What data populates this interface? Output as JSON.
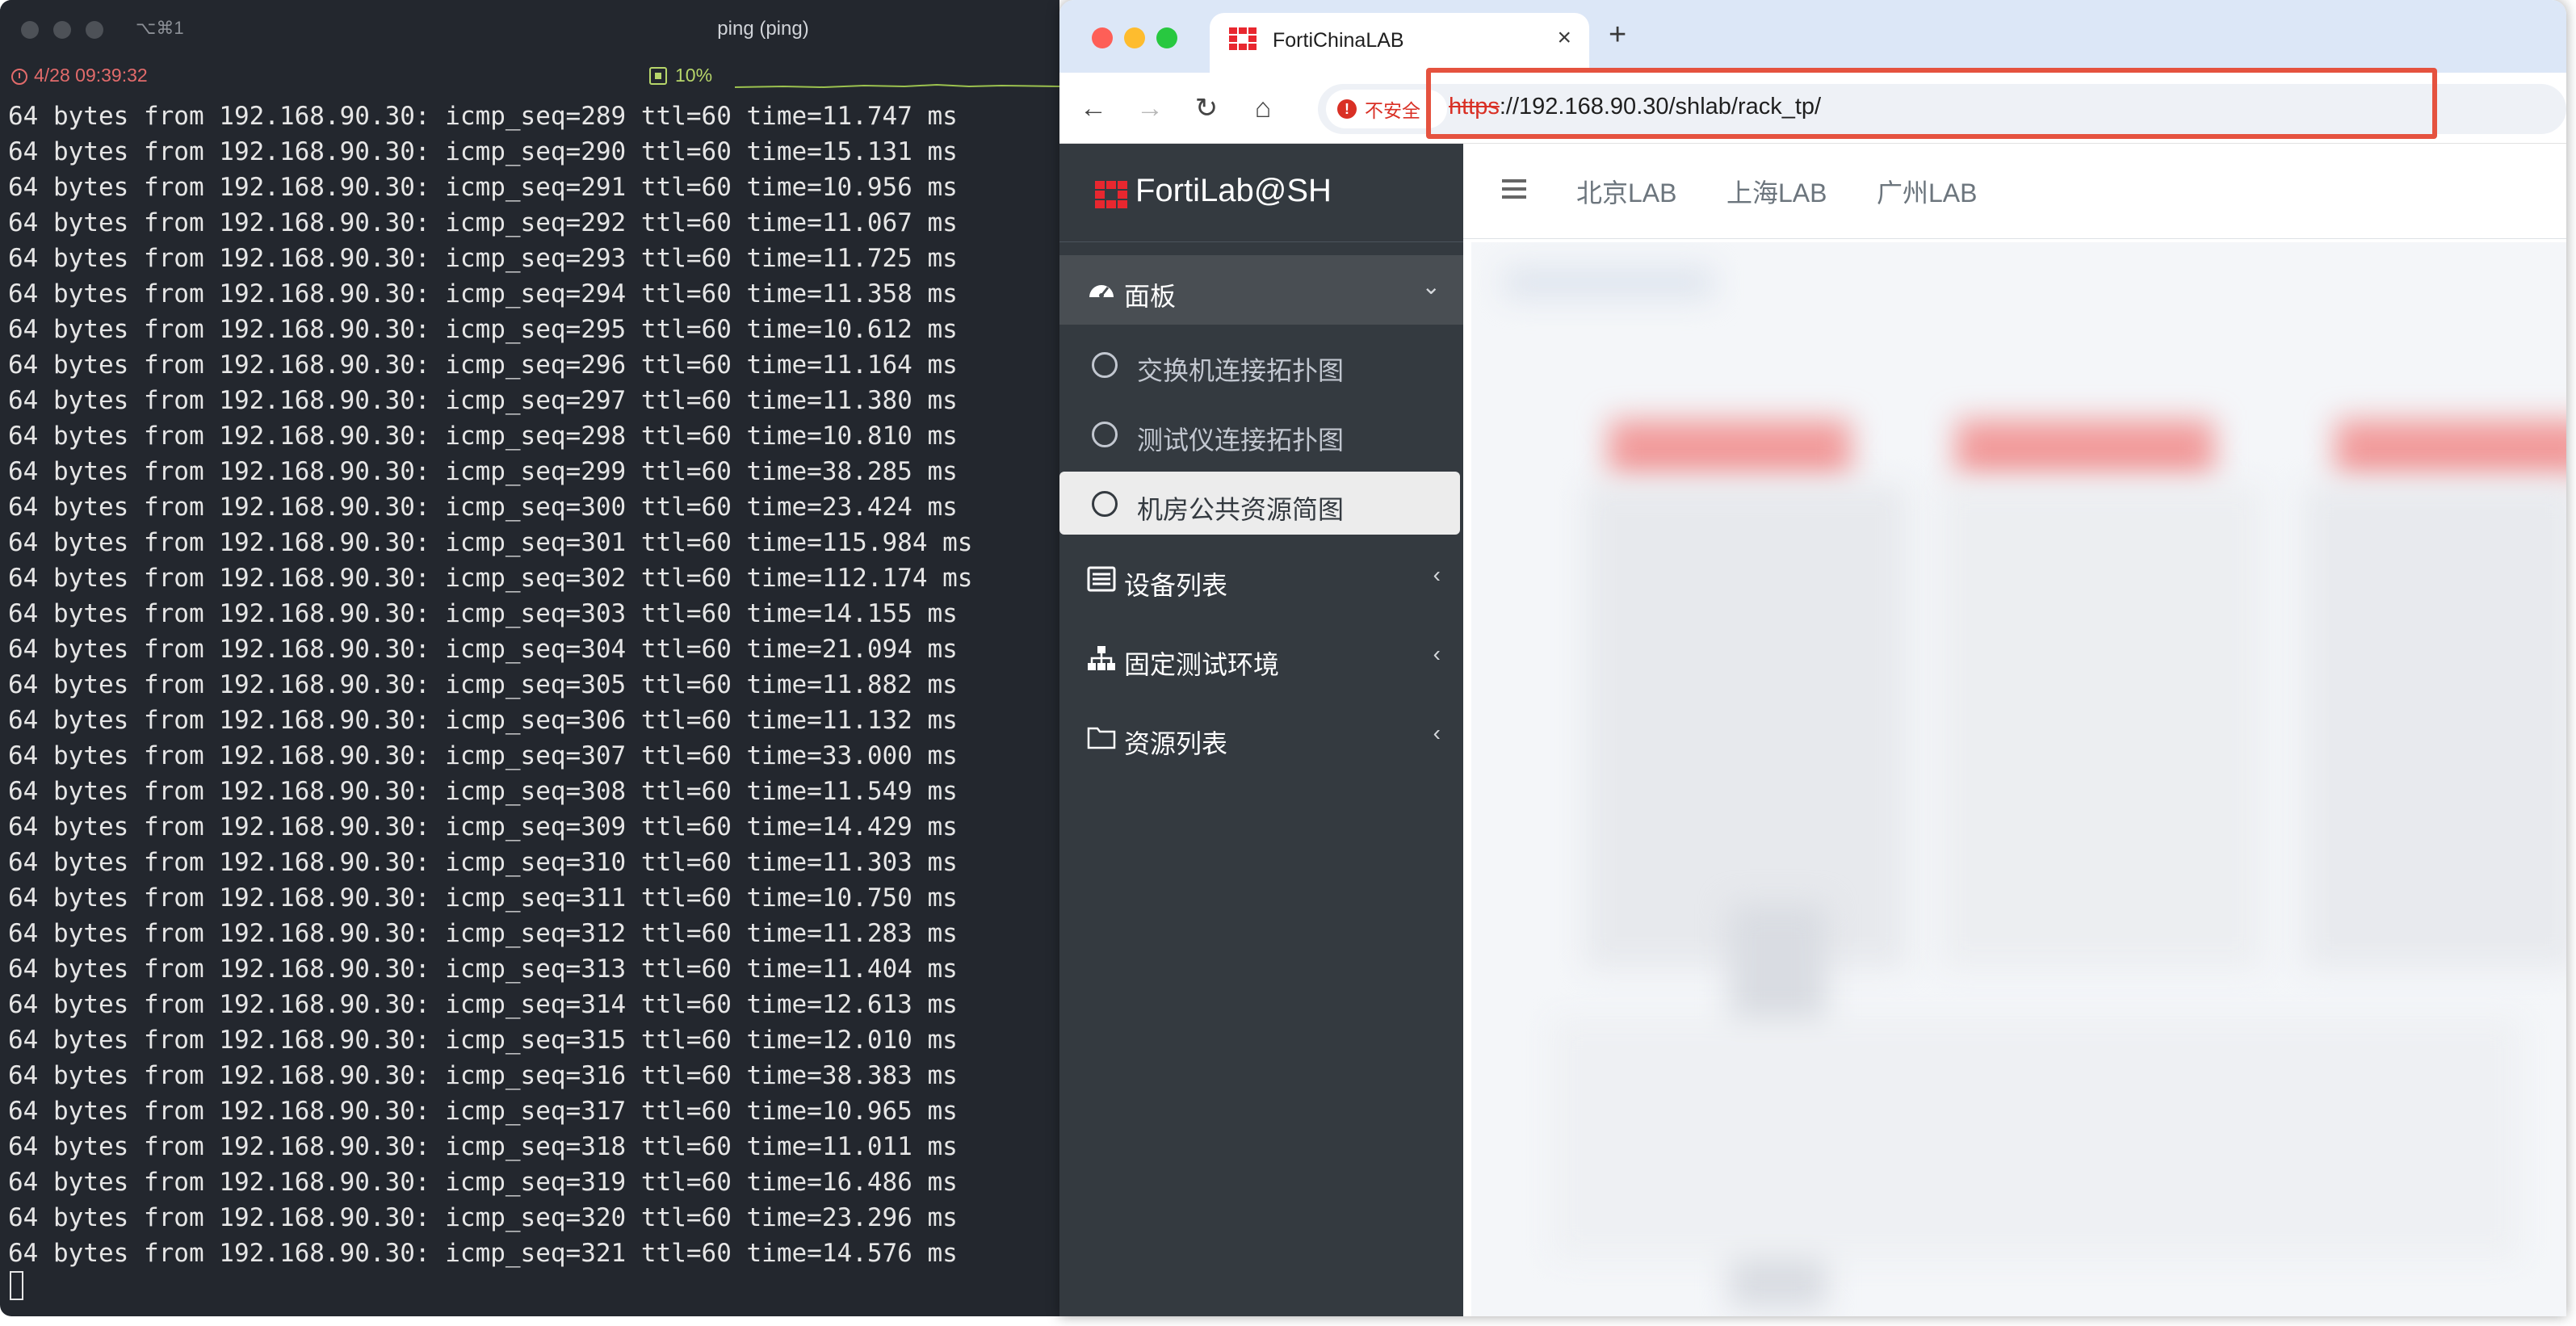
{
  "terminal": {
    "shortcut": "⌥⌘1",
    "title": "ping (ping)",
    "datetime": "4/28 09:39:32",
    "cpu": "10%",
    "lines": [
      "64 bytes from 192.168.90.30: icmp_seq=289 ttl=60 time=11.747 ms",
      "64 bytes from 192.168.90.30: icmp_seq=290 ttl=60 time=15.131 ms",
      "64 bytes from 192.168.90.30: icmp_seq=291 ttl=60 time=10.956 ms",
      "64 bytes from 192.168.90.30: icmp_seq=292 ttl=60 time=11.067 ms",
      "64 bytes from 192.168.90.30: icmp_seq=293 ttl=60 time=11.725 ms",
      "64 bytes from 192.168.90.30: icmp_seq=294 ttl=60 time=11.358 ms",
      "64 bytes from 192.168.90.30: icmp_seq=295 ttl=60 time=10.612 ms",
      "64 bytes from 192.168.90.30: icmp_seq=296 ttl=60 time=11.164 ms",
      "64 bytes from 192.168.90.30: icmp_seq=297 ttl=60 time=11.380 ms",
      "64 bytes from 192.168.90.30: icmp_seq=298 ttl=60 time=10.810 ms",
      "64 bytes from 192.168.90.30: icmp_seq=299 ttl=60 time=38.285 ms",
      "64 bytes from 192.168.90.30: icmp_seq=300 ttl=60 time=23.424 ms",
      "64 bytes from 192.168.90.30: icmp_seq=301 ttl=60 time=115.984 ms",
      "64 bytes from 192.168.90.30: icmp_seq=302 ttl=60 time=112.174 ms",
      "64 bytes from 192.168.90.30: icmp_seq=303 ttl=60 time=14.155 ms",
      "64 bytes from 192.168.90.30: icmp_seq=304 ttl=60 time=21.094 ms",
      "64 bytes from 192.168.90.30: icmp_seq=305 ttl=60 time=11.882 ms",
      "64 bytes from 192.168.90.30: icmp_seq=306 ttl=60 time=11.132 ms",
      "64 bytes from 192.168.90.30: icmp_seq=307 ttl=60 time=33.000 ms",
      "64 bytes from 192.168.90.30: icmp_seq=308 ttl=60 time=11.549 ms",
      "64 bytes from 192.168.90.30: icmp_seq=309 ttl=60 time=14.429 ms",
      "64 bytes from 192.168.90.30: icmp_seq=310 ttl=60 time=11.303 ms",
      "64 bytes from 192.168.90.30: icmp_seq=311 ttl=60 time=10.750 ms",
      "64 bytes from 192.168.90.30: icmp_seq=312 ttl=60 time=11.283 ms",
      "64 bytes from 192.168.90.30: icmp_seq=313 ttl=60 time=11.404 ms",
      "64 bytes from 192.168.90.30: icmp_seq=314 ttl=60 time=12.613 ms",
      "64 bytes from 192.168.90.30: icmp_seq=315 ttl=60 time=12.010 ms",
      "64 bytes from 192.168.90.30: icmp_seq=316 ttl=60 time=38.383 ms",
      "64 bytes from 192.168.90.30: icmp_seq=317 ttl=60 time=10.965 ms",
      "64 bytes from 192.168.90.30: icmp_seq=318 ttl=60 time=11.011 ms",
      "64 bytes from 192.168.90.30: icmp_seq=319 ttl=60 time=16.486 ms",
      "64 bytes from 192.168.90.30: icmp_seq=320 ttl=60 time=23.296 ms",
      "64 bytes from 192.168.90.30: icmp_seq=321 ttl=60 time=14.576 ms"
    ]
  },
  "browser": {
    "tab": {
      "title": "FortiChinaLAB",
      "close": "×"
    },
    "new_tab": "+",
    "toolbar": {
      "back": "←",
      "forward": "→",
      "reload": "↻",
      "home": "⌂"
    },
    "security": {
      "icon": "!",
      "label": "不安全"
    },
    "url": {
      "scheme": "https",
      "rest": "://192.168.90.30/shlab/rack_tp/"
    },
    "colors": {
      "highlight": "#e5523f",
      "sidebar": "#343a40",
      "insecure": "#d93025"
    }
  },
  "sidebar": {
    "brand": "FortiLab@SH",
    "items": [
      {
        "label": "面板",
        "icon": "dashboard-icon",
        "chevron": "⌄"
      },
      {
        "label": "设备列表",
        "icon": "list-icon",
        "chevron": "‹"
      },
      {
        "label": "固定测试环境",
        "icon": "sitemap-icon",
        "chevron": "‹"
      },
      {
        "label": "资源列表",
        "icon": "folder-icon",
        "chevron": "‹"
      }
    ],
    "subitems": [
      {
        "label": "交换机连接拓扑图"
      },
      {
        "label": "测试仪连接拓扑图"
      },
      {
        "label": "机房公共资源简图"
      }
    ]
  },
  "page_nav": {
    "links": [
      "北京LAB",
      "上海LAB",
      "广州LAB"
    ]
  }
}
